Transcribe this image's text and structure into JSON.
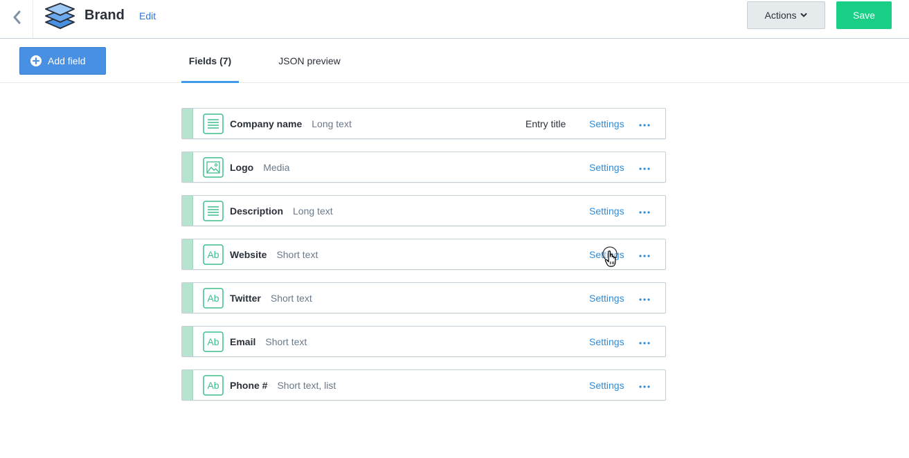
{
  "header": {
    "title": "Brand",
    "edit_label": "Edit",
    "actions_label": "Actions",
    "save_label": "Save",
    "icons": {
      "back": "chevron-left-icon",
      "logo": "layers-icon",
      "actions": "chevron-down-icon"
    }
  },
  "toolbar": {
    "add_field_label": "Add field",
    "add_icon": "plus-circle-icon"
  },
  "tabs": [
    {
      "label": "Fields (7)",
      "active": true
    },
    {
      "label": "JSON preview",
      "active": false
    }
  ],
  "fields": [
    {
      "name": "Company name",
      "type": "Long text",
      "badge": "Entry title",
      "settings": "Settings",
      "icon": "long-text-icon"
    },
    {
      "name": "Logo",
      "type": "Media",
      "badge": "",
      "settings": "Settings",
      "icon": "media-icon"
    },
    {
      "name": "Description",
      "type": "Long text",
      "badge": "",
      "settings": "Settings",
      "icon": "long-text-icon"
    },
    {
      "name": "Website",
      "type": "Short text",
      "badge": "",
      "settings": "Settings",
      "icon": "short-text-icon"
    },
    {
      "name": "Twitter",
      "type": "Short text",
      "badge": "",
      "settings": "Settings",
      "icon": "short-text-icon"
    },
    {
      "name": "Email",
      "type": "Short text",
      "badge": "",
      "settings": "Settings",
      "icon": "short-text-icon"
    },
    {
      "name": "Phone #",
      "type": "Short text, list",
      "badge": "",
      "settings": "Settings",
      "icon": "short-text-icon"
    }
  ],
  "short_text_glyph": "Ab",
  "colors": {
    "primary": "#4a90e2",
    "save": "#19cf86",
    "link": "#2e8bd6",
    "field_accent": "#b6e4cf",
    "icon_green": "#3cbf8c"
  }
}
